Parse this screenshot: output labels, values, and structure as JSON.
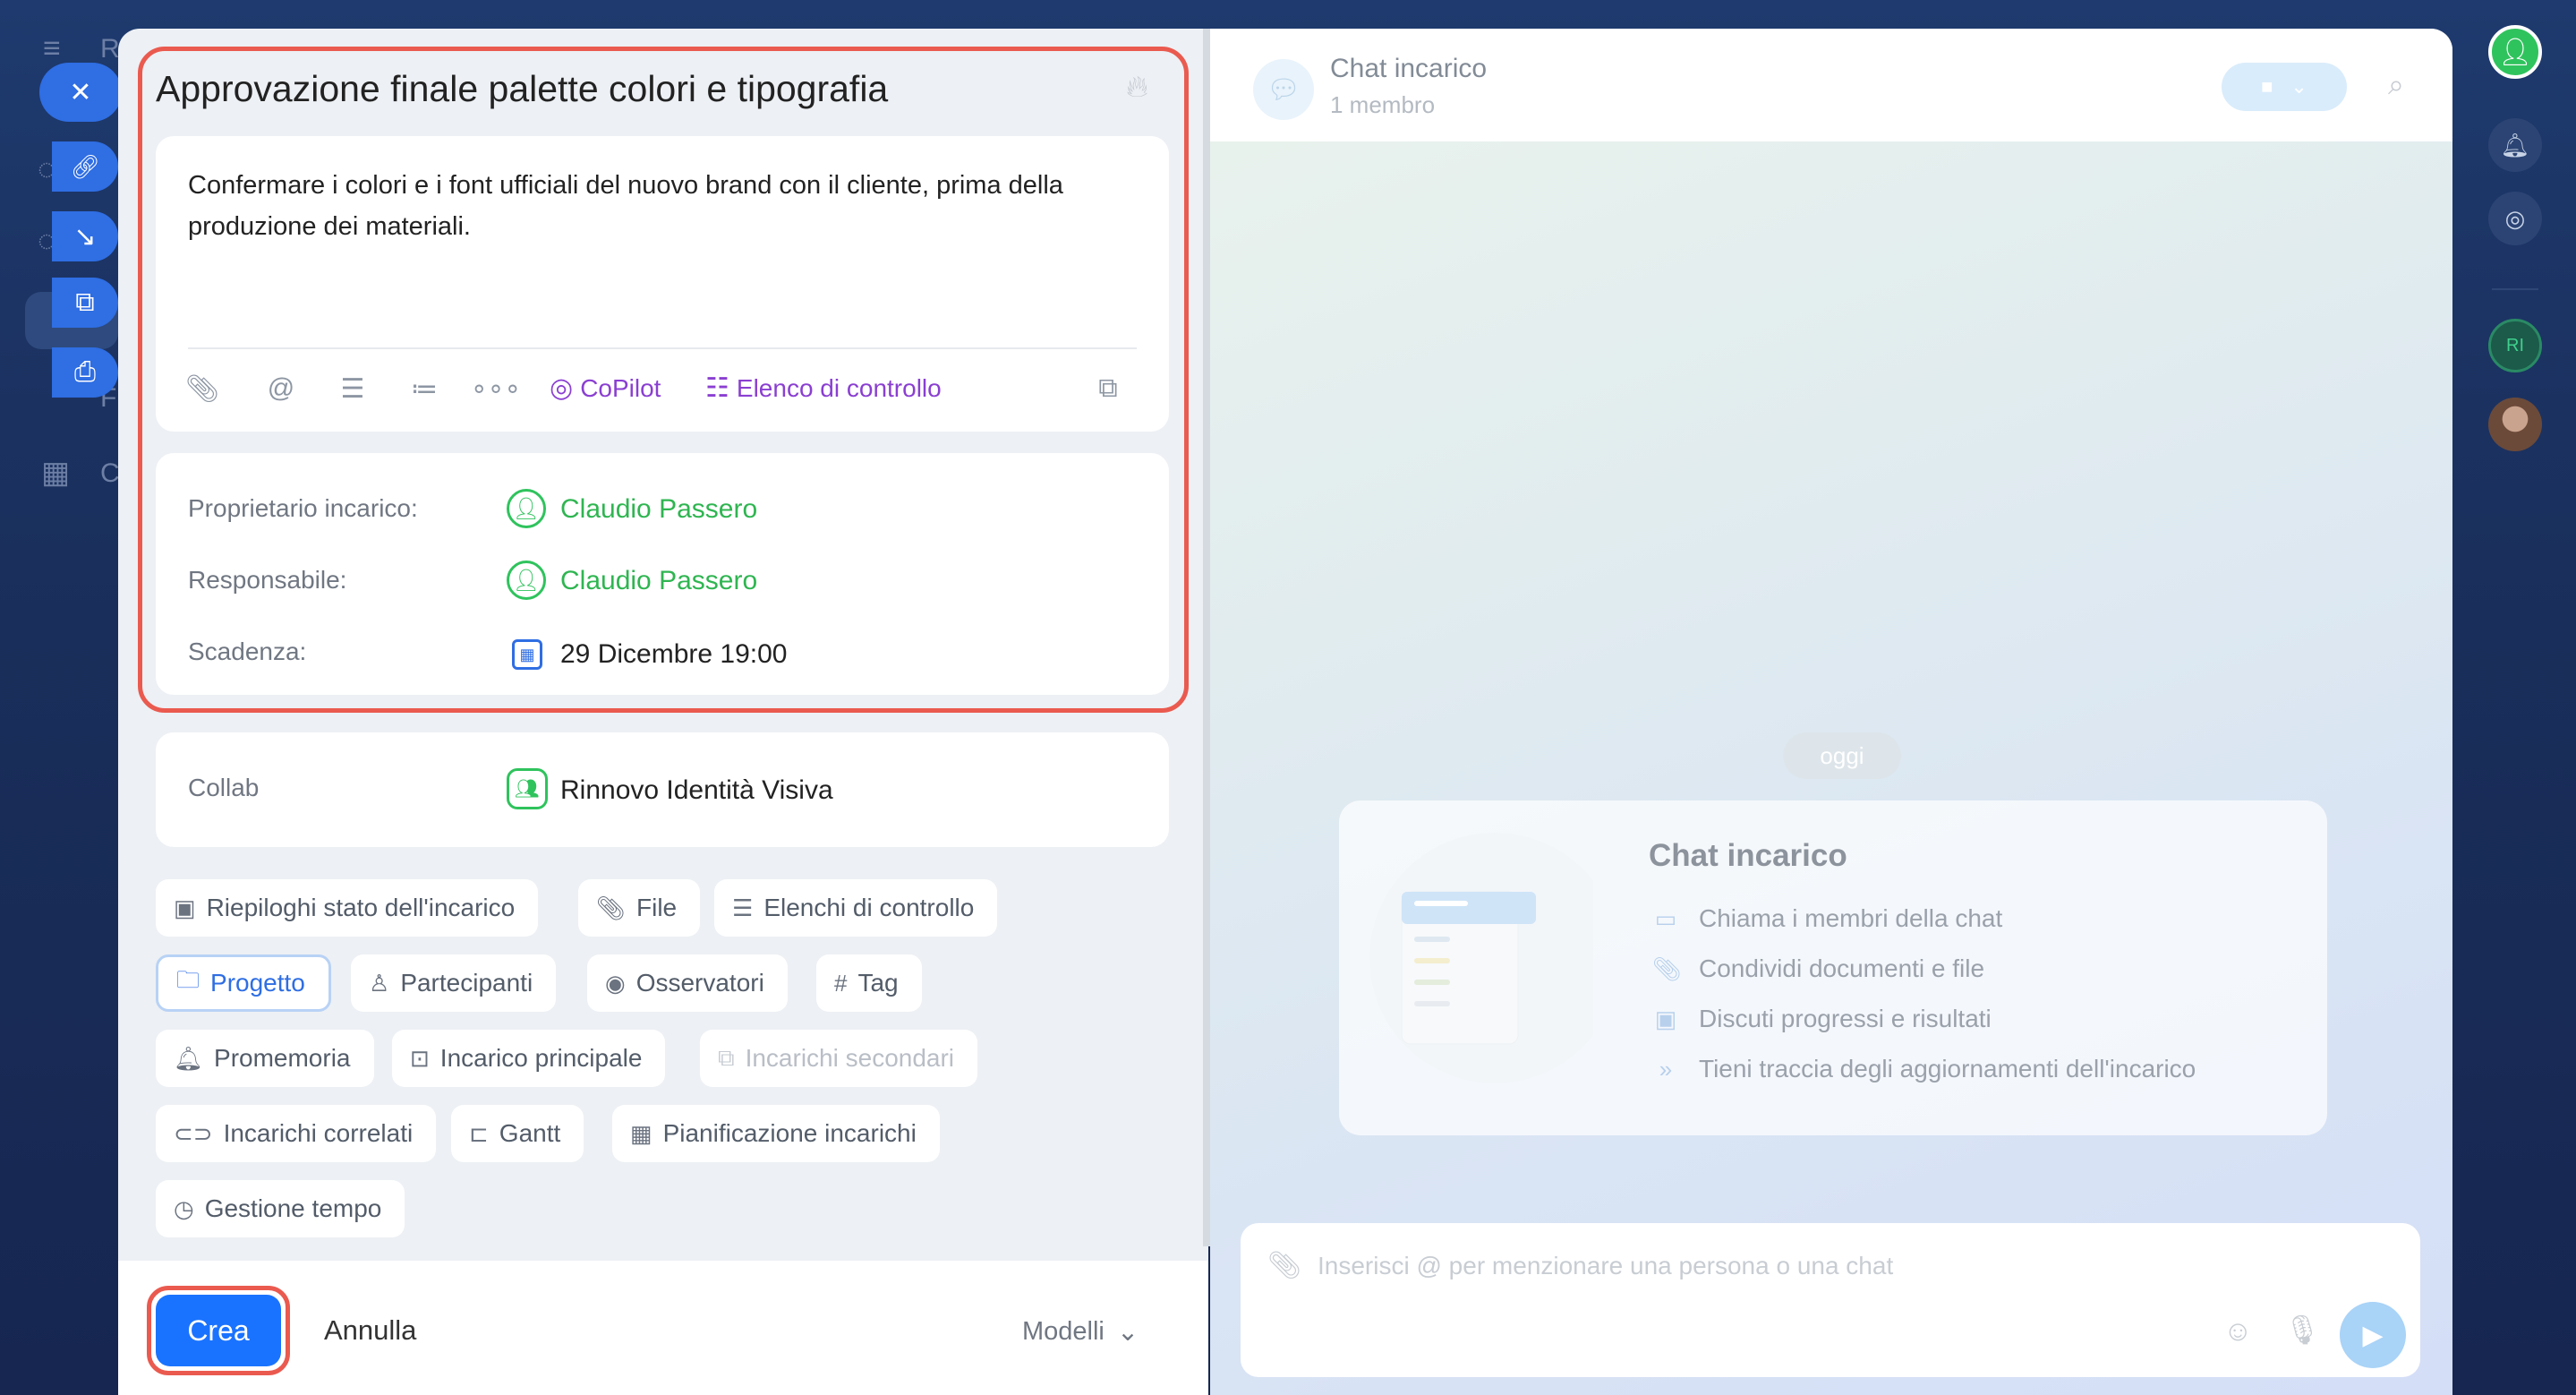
{
  "background_app": {
    "letters": [
      "R",
      "F",
      "C"
    ]
  },
  "task": {
    "title": "Approvazione finale palette colori e tipografia",
    "description": "Confermare i colori e i font ufficiali del nuovo brand con il cliente, prima della produzione dei materiali.",
    "toolbar": {
      "copilot_label": "CoPilot",
      "checklist_label": "Elenco di controllo"
    },
    "meta": {
      "owner_label": "Proprietario incarico:",
      "owner_value": "Claudio Passero",
      "responsible_label": "Responsabile:",
      "responsible_value": "Claudio Passero",
      "deadline_label": "Scadenza:",
      "deadline_value": "29 Dicembre 19:00"
    },
    "collab": {
      "label": "Collab",
      "value": "Rinnovo Identità Visiva"
    },
    "chips": [
      {
        "label": "Riepiloghi stato dell'incarico",
        "icon": "summary-icon"
      },
      {
        "label": "File",
        "icon": "paperclip-icon"
      },
      {
        "label": "Elenchi di controllo",
        "icon": "checklist-icon"
      },
      {
        "label": "Progetto",
        "icon": "folder-icon"
      },
      {
        "label": "Partecipanti",
        "icon": "person-icon"
      },
      {
        "label": "Osservatori",
        "icon": "eye-icon"
      },
      {
        "label": "Tag",
        "icon": "hash-icon"
      },
      {
        "label": "Promemoria",
        "icon": "bell-icon"
      },
      {
        "label": "Incarico principale",
        "icon": "parent-task-icon"
      },
      {
        "label": "Incarichi secondari",
        "icon": "subtasks-icon"
      },
      {
        "label": "Incarichi correlati",
        "icon": "link-icon"
      },
      {
        "label": "Gantt",
        "icon": "gantt-icon"
      },
      {
        "label": "Pianificazione incarichi",
        "icon": "calendar-plan-icon"
      },
      {
        "label": "Gestione tempo",
        "icon": "timer-icon"
      }
    ],
    "footer": {
      "create_label": "Crea",
      "cancel_label": "Annulla",
      "templates_label": "Modelli"
    }
  },
  "chat": {
    "title": "Chat incarico",
    "members": "1 membro",
    "date_separator": "oggi",
    "welcome": {
      "title": "Chat incarico",
      "items": [
        "Chiama i membri della chat",
        "Condividi documenti e file",
        "Discuti progressi e risultati",
        "Tieni traccia degli aggiornamenti dell'incarico"
      ]
    },
    "input_placeholder": "Inserisci @ per menzionare una persona o una chat"
  },
  "rail": {
    "avatar_initials": "RI"
  },
  "colors": {
    "accent_blue": "#1a73ff",
    "highlight_red": "#ea5a4f",
    "user_green": "#2fb551",
    "copilot_purple": "#8a3fd1"
  }
}
